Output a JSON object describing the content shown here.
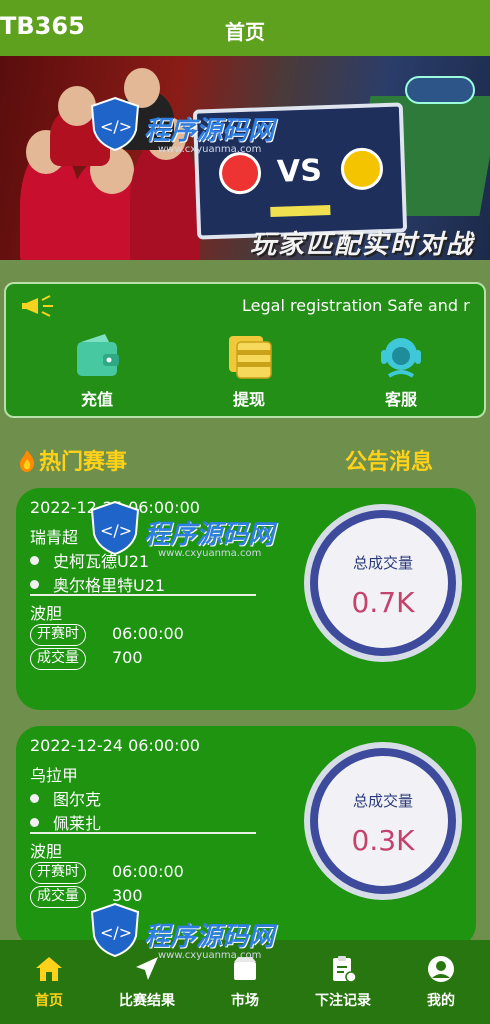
{
  "header": {
    "brand": "TB365",
    "title": "首页"
  },
  "banner": {
    "slogan": "玩家匹配实时对战",
    "screen_vs": "VS"
  },
  "notice": {
    "text": "Legal registration Safe and r"
  },
  "actions": [
    {
      "label": "充值",
      "icon": "wallet-icon"
    },
    {
      "label": "提现",
      "icon": "cards-icon"
    },
    {
      "label": "客服",
      "icon": "headset-icon"
    }
  ],
  "sections": {
    "hot": "热门赛事",
    "announcement": "公告消息"
  },
  "matches": [
    {
      "datetime": "2022-12-24 06:00:00",
      "league": "瑞青超",
      "teams": [
        "史柯瓦德U21",
        "奥尔格里特U21"
      ],
      "market": "波胆",
      "start_tag": "开赛时",
      "start_time": "06:00:00",
      "volume_tag": "成交量",
      "volume": "700",
      "total_label": "总成交量",
      "total_value": "0.7K"
    },
    {
      "datetime": "2022-12-24 06:00:00",
      "league": "乌拉甲",
      "teams": [
        "图尔克",
        "佩莱扎"
      ],
      "market": "波胆",
      "start_tag": "开赛时",
      "start_time": "06:00:00",
      "volume_tag": "成交量",
      "volume": "300",
      "total_label": "总成交量",
      "total_value": "0.3K"
    }
  ],
  "nav": [
    {
      "label": "首页",
      "icon": "home-icon",
      "active": true
    },
    {
      "label": "比赛结果",
      "icon": "send-icon",
      "active": false
    },
    {
      "label": "市场",
      "icon": "market-icon",
      "active": false
    },
    {
      "label": "下注记录",
      "icon": "clipboard-icon",
      "active": false
    },
    {
      "label": "我的",
      "icon": "profile-icon",
      "active": false
    }
  ],
  "watermark": {
    "text": "程序源码网",
    "url": "www.cxyuanma.com"
  },
  "colors": {
    "header": "#5ea11f",
    "card": "#1e9411",
    "accent": "#ffd21a",
    "gauge_ring": "#3e4b9c",
    "gauge_value": "#c4426b"
  }
}
